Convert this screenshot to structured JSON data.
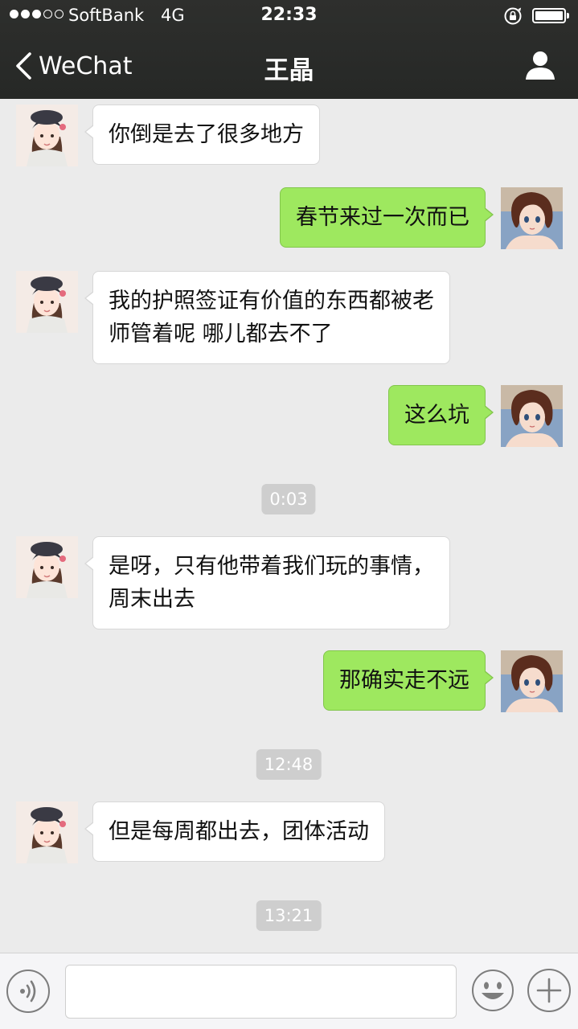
{
  "status_bar": {
    "carrier": "SoftBank",
    "network": "4G",
    "time": "22:33",
    "signal_bars_filled": 3,
    "signal_bars_total": 5
  },
  "nav": {
    "back_label": "WeChat",
    "title": "王晶",
    "back_icon": "chevron-left-icon",
    "profile_icon": "person-icon"
  },
  "messages": [
    {
      "side": "in",
      "text": "你倒是去了很多地方"
    },
    {
      "side": "out",
      "text": "春节来过一次而已"
    },
    {
      "side": "in",
      "text": "我的护照签证有价值的东西都被老\n师管着呢 哪儿都去不了"
    },
    {
      "side": "out",
      "text": "这么坑"
    },
    {
      "type": "timestamp",
      "text": "0:03"
    },
    {
      "side": "in",
      "text": "是呀，只有他带着我们玩的事情，\n周末出去"
    },
    {
      "side": "out",
      "text": "那确实走不远"
    },
    {
      "type": "timestamp",
      "text": "12:48"
    },
    {
      "side": "in",
      "text": "但是每周都出去，团体活动"
    },
    {
      "type": "timestamp",
      "text": "13:21"
    }
  ],
  "input_bar": {
    "placeholder": "",
    "voice_icon": "voice-icon",
    "emoji_icon": "emoji-icon",
    "plus_icon": "plus-icon"
  },
  "colors": {
    "nav_background": "#2e2f2d",
    "chat_background": "#ebebeb",
    "incoming_bubble": "#ffffff",
    "outgoing_bubble": "#9ee85f",
    "timestamp_pill": "#cecece"
  }
}
